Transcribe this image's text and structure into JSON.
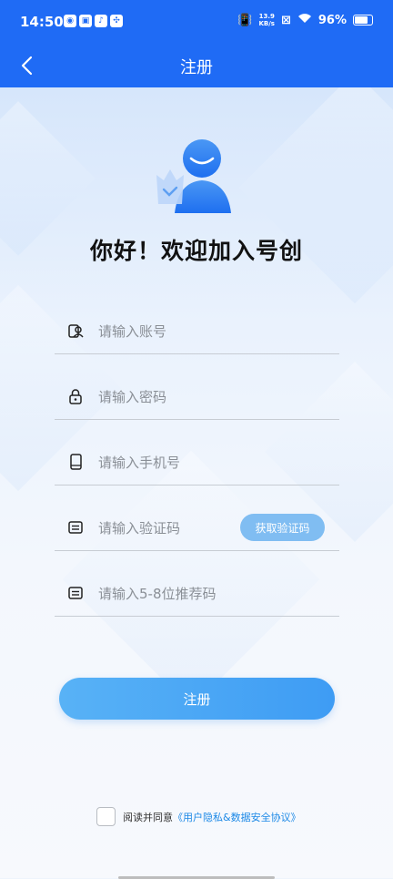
{
  "status_bar": {
    "time": "14:50",
    "net_speed_value": "13.9",
    "net_speed_unit": "KB/s",
    "battery": "96%"
  },
  "nav": {
    "title": "注册"
  },
  "hero": {
    "welcome": "你好！欢迎加入号创"
  },
  "form": {
    "account_placeholder": "请输入账号",
    "password_placeholder": "请输入密码",
    "phone_placeholder": "请输入手机号",
    "code_placeholder": "请输入验证码",
    "get_code_label": "获取验证码",
    "referral_placeholder": "请输入5-8位推荐码",
    "submit_label": "注册"
  },
  "agreement": {
    "prefix": "阅读并同意",
    "link": "《用户隐私&数据安全协议》"
  },
  "colors": {
    "primary": "#1f6bf5",
    "button": "#4aa6f5",
    "link": "#1b88e6"
  }
}
